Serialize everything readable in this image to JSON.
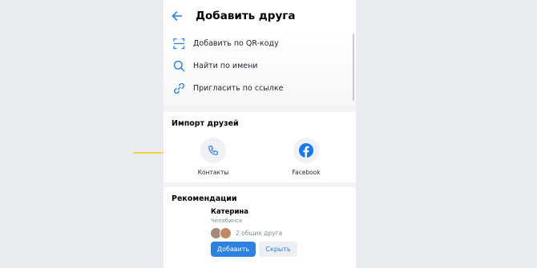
{
  "header": {
    "title": "Добавить друга",
    "back_icon": "arrow-left-icon"
  },
  "menu": {
    "items": [
      {
        "label": "Добавить по QR-коду",
        "icon": "qr-scan-icon"
      },
      {
        "label": "Найти по имени",
        "icon": "search-icon"
      },
      {
        "label": "Пригласить по ссылке",
        "icon": "link-icon"
      }
    ]
  },
  "import": {
    "title": "Импорт друзей",
    "items": [
      {
        "label": "Контакты",
        "icon": "phone-icon"
      },
      {
        "label": "Facebook",
        "icon": "facebook-icon"
      }
    ]
  },
  "recommendations": {
    "title": "Рекомендации",
    "name": "Катерина",
    "city": "Челябинск",
    "mutual": "2 общих друга",
    "add_label": "Добавить",
    "hide_label": "Скрыть"
  },
  "colors": {
    "accent": "#2d81e0",
    "facebook": "#1877f2",
    "annotation_arrow": "#f5d547",
    "background": "#ebecef"
  }
}
